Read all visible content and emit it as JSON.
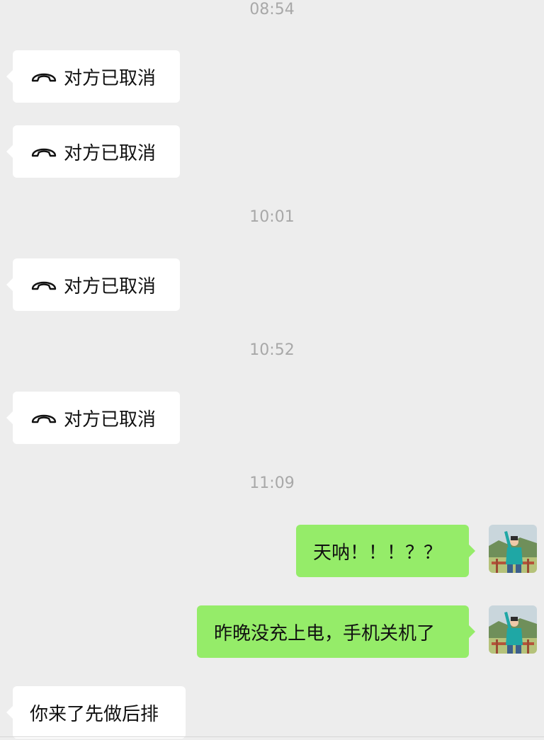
{
  "messages": {
    "ts1": "08:54",
    "call1": "对方已取消",
    "call2": "对方已取消",
    "ts2": "10:01",
    "call3": "对方已取消",
    "ts3": "10:52",
    "call4": "对方已取消",
    "ts4": "11:09",
    "sent1": "天呐！！！？？",
    "sent2": "昨晚没充上电，手机关机了",
    "recv1": "你来了先做后排"
  },
  "icons": {
    "call": "hangup-phone-icon",
    "avatar": "self-avatar"
  },
  "colors": {
    "background": "#ededed",
    "incoming_bubble": "#ffffff",
    "outgoing_bubble": "#95ec69",
    "timestamp": "#a8a8a8"
  }
}
